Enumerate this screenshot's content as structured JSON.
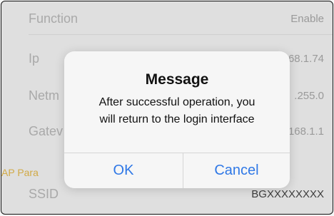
{
  "settings": {
    "function": {
      "label": "Function",
      "value": "Enable"
    },
    "ip": {
      "label": "Ip",
      "value": "68.1.74"
    },
    "netmask": {
      "label": "Netm",
      "value": ".255.0"
    },
    "gateway": {
      "label": "Gatev",
      "value": "168.1.1"
    },
    "ap_section_label": "AP Para",
    "ssid": {
      "label": "SSID",
      "value": "BGXXXXXXXX"
    }
  },
  "dialog": {
    "title": "Message",
    "message_line1": "After successful operation, you",
    "message_line2": "will return to the login interface",
    "ok_label": "OK",
    "cancel_label": "Cancel"
  }
}
